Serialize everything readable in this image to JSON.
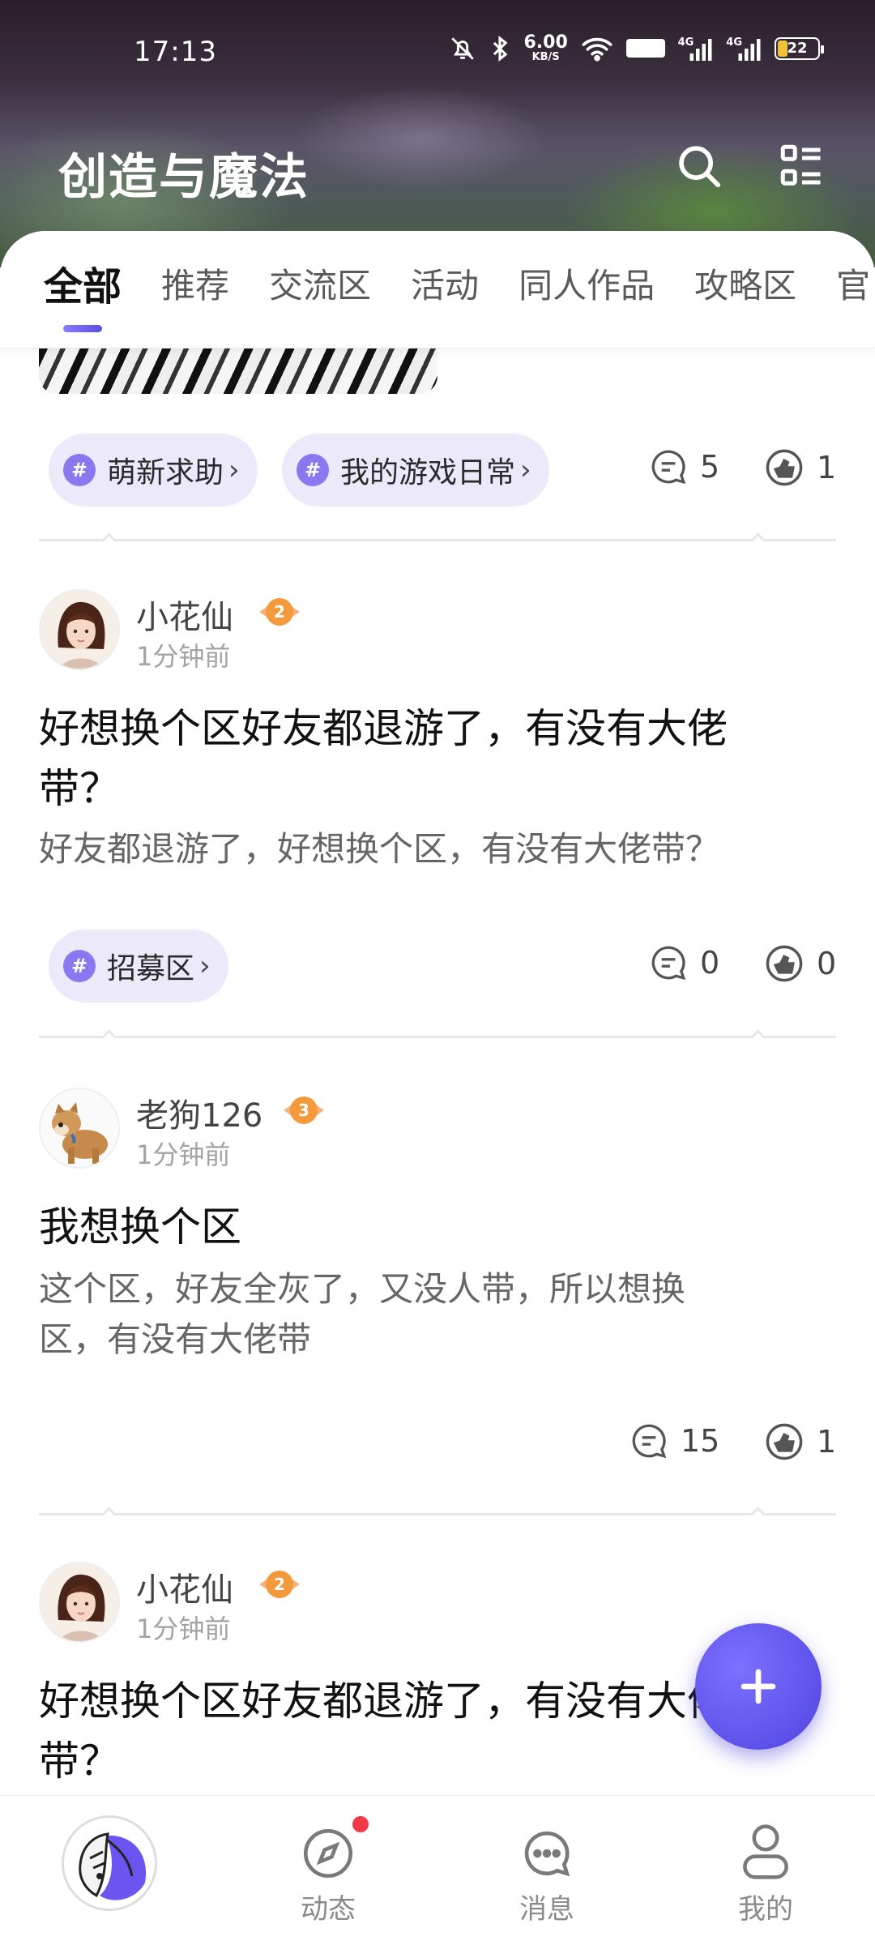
{
  "status_bar": {
    "time": "17:13",
    "net_speed_value": "6.00",
    "net_speed_unit": "KB/S",
    "hd_label": "HD2",
    "signal1_label": "4G",
    "signal2_label": "4G",
    "battery": "22"
  },
  "header": {
    "title": "创造与魔法"
  },
  "tabs": [
    {
      "label": "全部",
      "active": true
    },
    {
      "label": "推荐"
    },
    {
      "label": "交流区"
    },
    {
      "label": "活动"
    },
    {
      "label": "同人作品"
    },
    {
      "label": "攻略区"
    },
    {
      "label": "官"
    }
  ],
  "prev_post": {
    "tags": [
      {
        "label": "萌新求助",
        "icon": "#"
      },
      {
        "label": "我的游戏日常",
        "icon": "#"
      }
    ],
    "comments": "5",
    "likes": "1"
  },
  "posts": [
    {
      "author": "小花仙",
      "level": "2",
      "time": "1分钟前",
      "title_line1": "好想换个区好友都退游了，有没有大佬",
      "title_line2": "带？",
      "body_line1": "好友都退游了，好想换个区，有没有大佬带？",
      "tags": [
        {
          "label": "招募区",
          "icon": "#"
        }
      ],
      "comments": "0",
      "likes": "0"
    },
    {
      "author": "老狗126",
      "level": "3",
      "time": "1分钟前",
      "title_line1": "我想换个区",
      "body_line1": "这个区，好友全灰了，又没人带，所以想换",
      "body_line2": "区，有没有大佬带",
      "comments": "15",
      "likes": "1"
    },
    {
      "author": "小花仙",
      "level": "2",
      "time": "1分钟前",
      "title_line1": "好想换个区好友都退游了，有没有大佬",
      "title_line2": "带？"
    }
  ],
  "bottom_nav": [
    {
      "label": "",
      "icon": "home-logo"
    },
    {
      "label": "动态",
      "icon": "compass-icon",
      "badge": true
    },
    {
      "label": "消息",
      "icon": "message-icon"
    },
    {
      "label": "我的",
      "icon": "profile-icon"
    }
  ],
  "colors": {
    "accent": "#5b4fe0",
    "tag_bg": "#ece9fb",
    "badge_red": "#f2394a",
    "level_orange": "#f39a3d"
  }
}
